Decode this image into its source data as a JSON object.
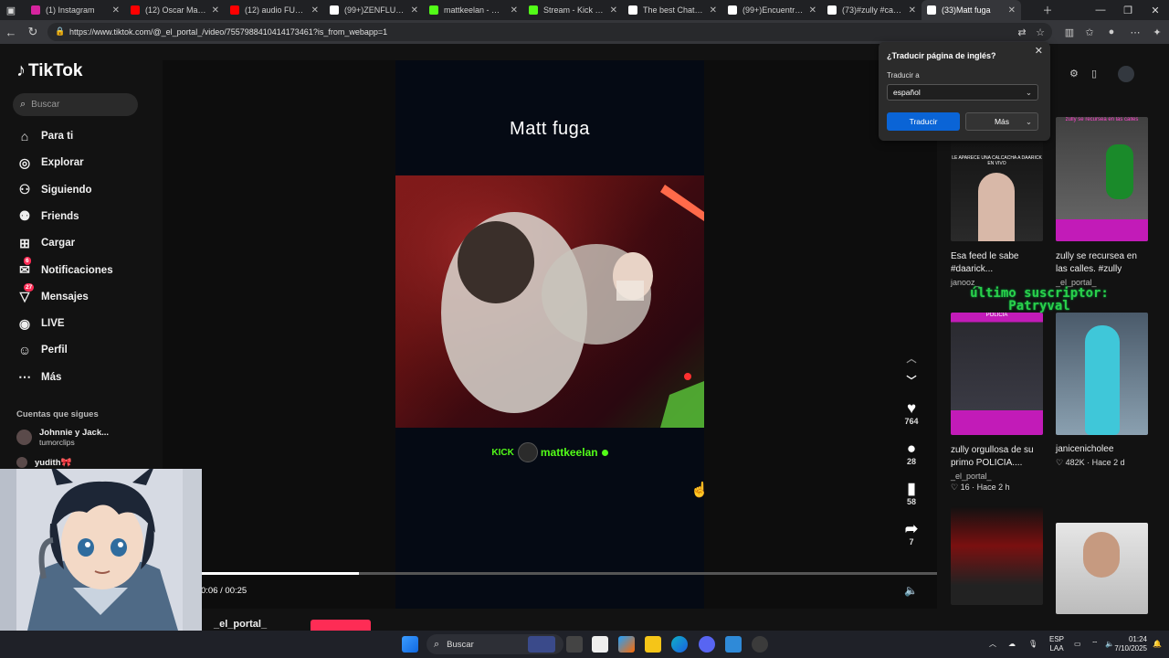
{
  "browser": {
    "tabs": [
      {
        "title": "(1) Instagram",
        "color": "#d6249f"
      },
      {
        "title": "(12) Oscar Maydon",
        "color": "#ff0000"
      },
      {
        "title": "(12) audio FUEGO,",
        "color": "#ff0000"
      },
      {
        "title": "(99+)ZENFLUENCER",
        "color": "#ffffff"
      },
      {
        "title": "mattkeelan - Watch",
        "color": "#53fc18"
      },
      {
        "title": "Stream - Kick Dash",
        "color": "#53fc18"
      },
      {
        "title": "The best ChatBot a",
        "color": "#ffffff"
      },
      {
        "title": "(99+)Encuentra 'Q",
        "color": "#ffffff"
      },
      {
        "title": "(73)#zully #cañita",
        "color": "#ffffff"
      },
      {
        "title": "(33)Matt fuga",
        "color": "#ffffff",
        "active": true
      }
    ],
    "url": "https://www.tiktok.com/@_el_portal_/video/7557988410414173461?is_from_webapp=1"
  },
  "tiktok": {
    "logo": "TikTok",
    "search_placeholder": "Buscar",
    "nav": [
      {
        "label": "Para ti",
        "icon": "home-icon"
      },
      {
        "label": "Explorar",
        "icon": "compass-icon"
      },
      {
        "label": "Siguiendo",
        "icon": "person-follow-icon"
      },
      {
        "label": "Friends",
        "icon": "friends-icon"
      },
      {
        "label": "Cargar",
        "icon": "upload-icon"
      },
      {
        "label": "Notificaciones",
        "icon": "bell-icon",
        "badge": "6"
      },
      {
        "label": "Mensajes",
        "icon": "message-icon",
        "badge": "27"
      },
      {
        "label": "LIVE",
        "icon": "live-icon"
      },
      {
        "label": "Perfil",
        "icon": "profile-icon"
      },
      {
        "label": "Más",
        "icon": "more-icon"
      }
    ],
    "following_header": "Cuentas que sigues",
    "following": [
      {
        "name": "Johnnie y Jack...",
        "sub": "tumorclips"
      },
      {
        "name": "yudith🎀",
        "sub": ""
      }
    ]
  },
  "video": {
    "title": "Matt fuga",
    "kick_label": "KICK",
    "streamer": "mattkeelan",
    "likes": "764",
    "comments": "28",
    "saves": "58",
    "shares": "7",
    "time": "0:06 / 00:25",
    "progress": 0.215,
    "author": "_el_portal_"
  },
  "translate_popup": {
    "title": "¿Traducir página de inglés?",
    "label": "Traducir a",
    "language": "español",
    "translate_button": "Traducir",
    "more_button": "Más"
  },
  "overlay_text": [
    "último suscriptor:",
    "Patryval"
  ],
  "recommendations": [
    {
      "title": "Esa feed le sabe #daarick...",
      "author": "janooz_",
      "meta": "",
      "thumb_text": "LE APARECE UNA CALCACHA A DAARICK EN VIVO"
    },
    {
      "title": "zully se recursea en las calles. #zully",
      "author": "_el_portal_",
      "meta": "",
      "thumb_text": "zully se recursea en las calles"
    },
    {
      "title": "zully orgullosa de su primo POLICIA....",
      "author": "_el_portal_",
      "meta": "16 · Hace 2 h",
      "thumb_text": "POLICIA"
    },
    {
      "title": "janicenicholee",
      "author": "",
      "meta": "482K · Hace 2 d",
      "thumb_text": ""
    },
    {
      "title": "",
      "author": "",
      "meta": "",
      "thumb_text": ""
    },
    {
      "title": "",
      "author": "",
      "meta": "",
      "thumb_text": ""
    }
  ],
  "taskbar": {
    "search": "Buscar",
    "lang": [
      "ESP",
      "LAA"
    ],
    "time": "01:24",
    "date": "7/10/2025"
  }
}
